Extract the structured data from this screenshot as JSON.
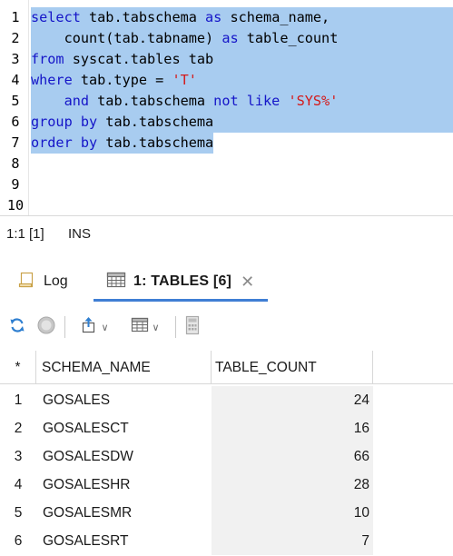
{
  "editor": {
    "lines": [
      {
        "n": "1",
        "tokens": [
          [
            "kw",
            "select"
          ],
          [
            "t",
            " tab.tabschema "
          ],
          [
            "kw",
            "as"
          ],
          [
            "t",
            " schema_name,"
          ]
        ]
      },
      {
        "n": "2",
        "tokens": [
          [
            "t",
            "    count(tab.tabname) "
          ],
          [
            "kw",
            "as"
          ],
          [
            "t",
            " table_count"
          ]
        ]
      },
      {
        "n": "3",
        "tokens": [
          [
            "kw",
            "from"
          ],
          [
            "t",
            " syscat.tables tab"
          ]
        ]
      },
      {
        "n": "4",
        "tokens": [
          [
            "kw",
            "where"
          ],
          [
            "t",
            " tab.type = "
          ],
          [
            "str",
            "'T'"
          ]
        ]
      },
      {
        "n": "5",
        "tokens": [
          [
            "t",
            "    "
          ],
          [
            "kw",
            "and"
          ],
          [
            "t",
            " tab.tabschema "
          ],
          [
            "kw",
            "not like"
          ],
          [
            "t",
            " "
          ],
          [
            "str",
            "'SYS%'"
          ]
        ]
      },
      {
        "n": "6",
        "tokens": [
          [
            "kw",
            "group by"
          ],
          [
            "t",
            " tab.tabschema"
          ]
        ]
      },
      {
        "n": "7",
        "tokens": [
          [
            "kw",
            "order by"
          ],
          [
            "t",
            " tab.tabschema"
          ]
        ]
      },
      {
        "n": "8",
        "tokens": []
      },
      {
        "n": "9",
        "tokens": []
      },
      {
        "n": "10",
        "tokens": []
      }
    ],
    "selection_color": "#a8ccf0",
    "keyword_color": "#1515c8",
    "string_color": "#d41a1a"
  },
  "status": {
    "position": "1:1 [1]",
    "mode": "INS"
  },
  "tabs": {
    "log_label": "Log",
    "tables_label": "1: TABLES [6]",
    "active_color": "#3f7ed4"
  },
  "toolbar": {
    "icons": [
      "refresh-icon",
      "stop-icon",
      "export-icon",
      "grid-view-icon",
      "calculator-icon"
    ]
  },
  "grid": {
    "corner": "*",
    "columns": [
      "SCHEMA_NAME",
      "TABLE_COUNT"
    ],
    "rows": [
      {
        "idx": "1",
        "schema_name": "GOSALES",
        "table_count": "24"
      },
      {
        "idx": "2",
        "schema_name": "GOSALESCT",
        "table_count": "16"
      },
      {
        "idx": "3",
        "schema_name": "GOSALESDW",
        "table_count": "66"
      },
      {
        "idx": "4",
        "schema_name": "GOSALESHR",
        "table_count": "28"
      },
      {
        "idx": "5",
        "schema_name": "GOSALESMR",
        "table_count": "10"
      },
      {
        "idx": "6",
        "schema_name": "GOSALESRT",
        "table_count": "7"
      }
    ]
  }
}
